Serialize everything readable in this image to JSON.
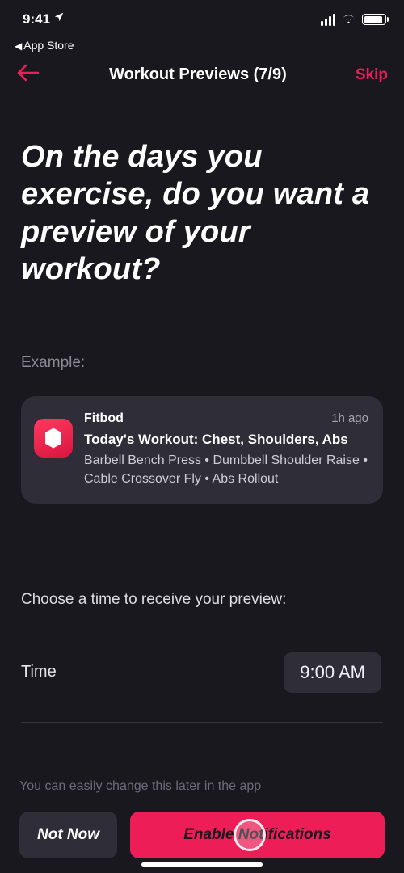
{
  "status": {
    "time": "9:41",
    "back_app_label": "App Store"
  },
  "nav": {
    "title": "Workout Previews (7/9)",
    "skip": "Skip"
  },
  "headline": "On the days you exercise, do you want a preview of your workout?",
  "example_label": "Example:",
  "notification": {
    "app": "Fitbod",
    "ago": "1h ago",
    "title": "Today's Workout: Chest, Shoulders, Abs",
    "detail": "Barbell Bench Press • Dumbbell Shoulder Raise • Cable Crossover Fly • Abs Rollout"
  },
  "choose_label": "Choose a time to receive your preview:",
  "time": {
    "label": "Time",
    "value": "9:00 AM"
  },
  "footer": {
    "hint": "You can easily change this later in the app",
    "not_now": "Not Now",
    "enable": "Enable Notifications"
  },
  "colors": {
    "accent": "#ed1e57"
  }
}
